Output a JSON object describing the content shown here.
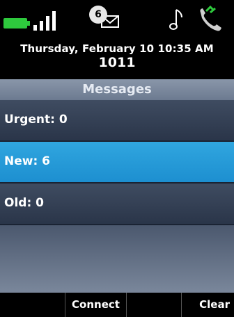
{
  "status": {
    "message_count": "6",
    "battery_color": "#2ec93d",
    "icons": [
      "battery-icon",
      "signal-icon",
      "voicemail-icon",
      "music-note-icon",
      "handset-icon"
    ]
  },
  "header": {
    "datetime": "Thursday, February 10 10:35 AM",
    "extension": "1011"
  },
  "screen_title": "Messages",
  "messages": {
    "items": [
      {
        "label": "Urgent: 0",
        "selected": false
      },
      {
        "label": "New: 6",
        "selected": true
      },
      {
        "label": "Old: 0",
        "selected": false
      }
    ]
  },
  "softkeys": [
    {
      "label": ""
    },
    {
      "label": "Connect"
    },
    {
      "label": ""
    },
    {
      "label": "Clear"
    }
  ],
  "colors": {
    "selected_row": "#1d8fd0",
    "row": "#2a3549",
    "title_bar": "#6c7a90"
  }
}
